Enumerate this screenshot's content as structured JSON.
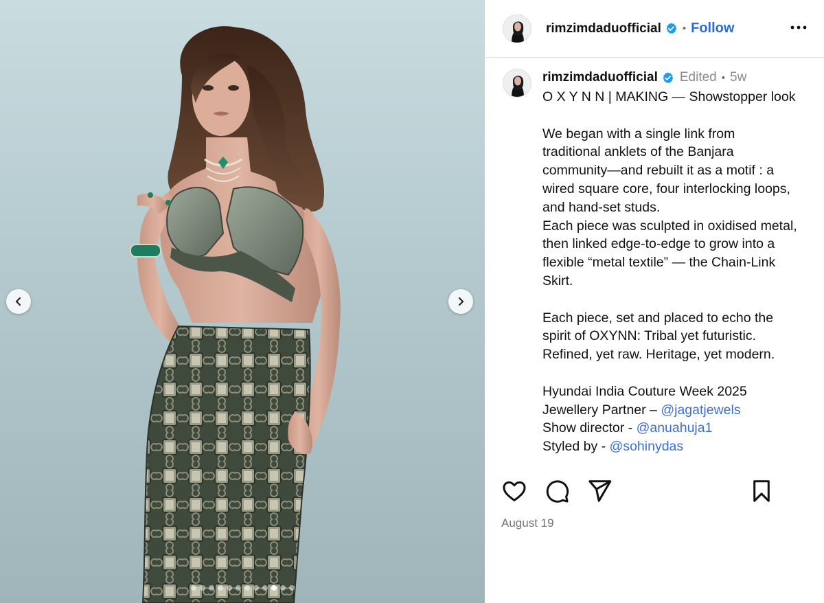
{
  "post": {
    "username": "rimzimdaduofficial",
    "follow_label": "Follow",
    "edited_label": "Edited",
    "age": "5w",
    "date": "August 19",
    "carousel": {
      "slide_count": 12,
      "active_index": 9
    }
  },
  "caption": {
    "title": "O X Y N N | MAKING — Showstopper look",
    "para1": [
      "We began with a single link from",
      "traditional anklets of the Banjara",
      "community—and rebuilt it as a motif : a",
      "wired square core, four interlocking loops,",
      "and hand-set studs.",
      "Each piece was sculpted in oxidised metal,",
      "then linked edge-to-edge to grow into a",
      "flexible “metal textile” — the Chain-Link",
      "Skirt."
    ],
    "para2": [
      "Each piece, set and placed to echo the",
      "spirit of OXYNN: Tribal yet futuristic.",
      "Refined, yet raw. Heritage, yet modern."
    ],
    "event": "Hyundai India Couture Week 2025",
    "jewellery_label": "Jewellery Partner – ",
    "jewellery_mention": "@jagatjewels",
    "director_label": "Show director - ",
    "director_mention": "@anuahuja1",
    "styled_label": "Styled by - ",
    "styled_mention": "@sohinydas"
  },
  "icons": {
    "header_more": "more-horizontal-icon",
    "verified": "verified-badge-icon",
    "actions": [
      "heart-icon",
      "comment-icon",
      "share-icon",
      "bookmark-icon"
    ],
    "carousel": [
      "chevron-left-icon",
      "chevron-right-icon"
    ]
  },
  "colors": {
    "link": "#3b6fd8",
    "follow": "#2a6bd6",
    "verified": "#1d9bf0",
    "muted": "#8a8a8a"
  }
}
